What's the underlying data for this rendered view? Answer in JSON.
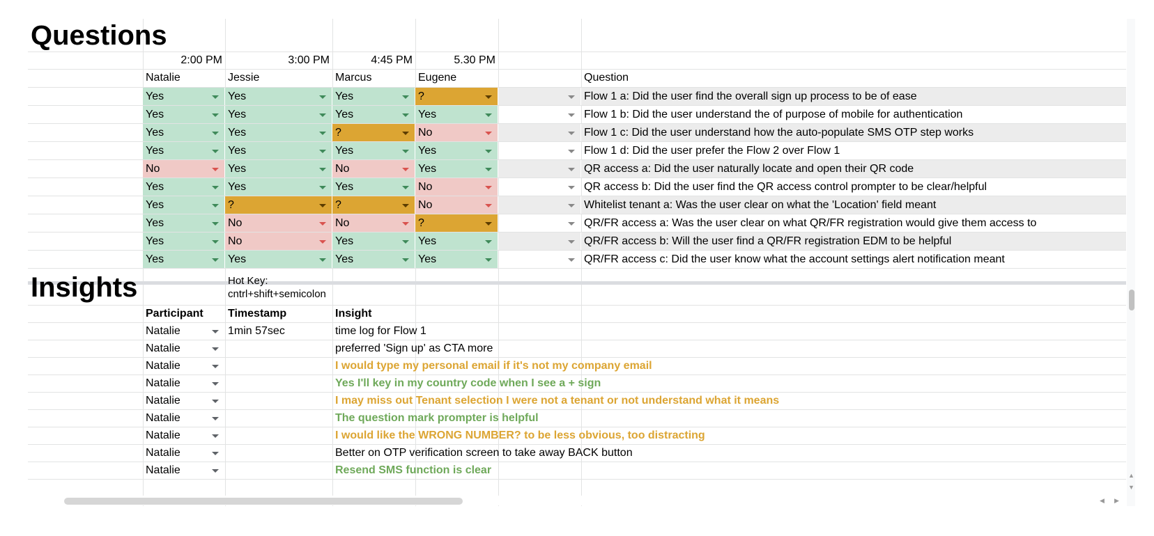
{
  "questions_section": {
    "title": "Questions",
    "times": [
      "2:00 PM",
      "3:00 PM",
      "4:45 PM",
      "5.30 PM"
    ],
    "participants": [
      "Natalie",
      "Jessie",
      "Marcus",
      "Eugene"
    ],
    "question_header": "Question",
    "rows": [
      {
        "answers": [
          "Yes",
          "Yes",
          "Yes",
          "?"
        ],
        "question": "Flow 1 a: Did the user find the overall sign up process to be of ease"
      },
      {
        "answers": [
          "Yes",
          "Yes",
          "Yes",
          "Yes"
        ],
        "question": "Flow 1 b: Did the user understand the of purpose of mobile for authentication"
      },
      {
        "answers": [
          "Yes",
          "Yes",
          "?",
          "No"
        ],
        "question": "Flow 1 c: Did the user understand how the auto-populate SMS OTP step works"
      },
      {
        "answers": [
          "Yes",
          "Yes",
          "Yes",
          "Yes"
        ],
        "question": "Flow 1 d: Did the user prefer the Flow 2 over Flow 1"
      },
      {
        "answers": [
          "No",
          "Yes",
          "No",
          "Yes"
        ],
        "question": "QR access a: Did the user naturally locate and open their QR code"
      },
      {
        "answers": [
          "Yes",
          "Yes",
          "Yes",
          "No"
        ],
        "question": "QR access b: Did the user find the QR access control prompter to be clear/helpful"
      },
      {
        "answers": [
          "Yes",
          "?",
          "?",
          "No"
        ],
        "question": "Whitelist tenant a: Was the user clear on what the 'Location' field meant"
      },
      {
        "answers": [
          "Yes",
          "No",
          "No",
          "?"
        ],
        "question": "QR/FR access a: Was the user clear on what QR/FR registration would give them access to"
      },
      {
        "answers": [
          "Yes",
          "No",
          "Yes",
          "Yes"
        ],
        "question": "QR/FR access b: Will the user find a QR/FR registration EDM to be helpful"
      },
      {
        "answers": [
          "Yes",
          "Yes",
          "Yes",
          "Yes"
        ],
        "question": "QR/FR access c: Did the user know what the account settings alert notification meant"
      }
    ]
  },
  "insights_section": {
    "title": "Insights",
    "hotkey": "Hot Key: cntrl+shift+semicolon",
    "headers": {
      "participant": "Participant",
      "timestamp": "Timestamp",
      "insight": "Insight"
    },
    "rows": [
      {
        "participant": "Natalie",
        "timestamp": "1min 57sec",
        "insight": "time log for Flow 1",
        "style": "plain"
      },
      {
        "participant": "Natalie",
        "timestamp": "",
        "insight": "preferred 'Sign up' as CTA more",
        "style": "plain"
      },
      {
        "participant": "Natalie",
        "timestamp": "",
        "insight": "I would type my personal email if it's not my company email",
        "style": "orange"
      },
      {
        "participant": "Natalie",
        "timestamp": "",
        "insight": "Yes I'll key in my country code when I see a + sign",
        "style": "green"
      },
      {
        "participant": "Natalie",
        "timestamp": "",
        "insight": "I may miss out Tenant selection I were not a tenant or not understand what it means",
        "style": "orange"
      },
      {
        "participant": "Natalie",
        "timestamp": "",
        "insight": "The question mark prompter is helpful",
        "style": "green"
      },
      {
        "participant": "Natalie",
        "timestamp": "",
        "insight": "I would like the WRONG NUMBER? to be less obvious, too distracting",
        "style": "orange"
      },
      {
        "participant": "Natalie",
        "timestamp": "",
        "insight": "Better on OTP verification screen to take away BACK button",
        "style": "plain"
      },
      {
        "participant": "Natalie",
        "timestamp": "",
        "insight": "Resend SMS function is clear",
        "style": "green"
      }
    ]
  },
  "scrollbar_arrows": {
    "up": "▲",
    "down": "▼",
    "left": "◀",
    "right": "▶"
  },
  "colors": {
    "yes": "#bfe3cf",
    "no": "#f0c9c6",
    "unsure": "#dca533",
    "insight_orange": "#dca533",
    "insight_green": "#6fa95a"
  }
}
